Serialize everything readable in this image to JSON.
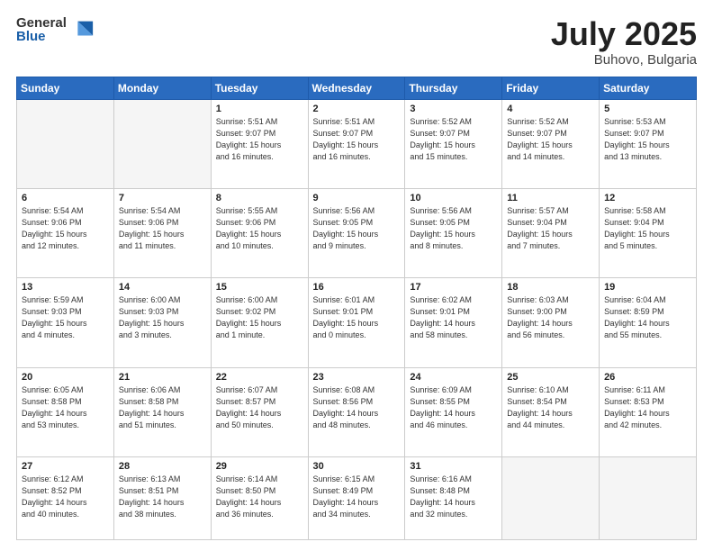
{
  "logo": {
    "general": "General",
    "blue": "Blue"
  },
  "header": {
    "month": "July 2025",
    "location": "Buhovo, Bulgaria"
  },
  "weekdays": [
    "Sunday",
    "Monday",
    "Tuesday",
    "Wednesday",
    "Thursday",
    "Friday",
    "Saturday"
  ],
  "weeks": [
    [
      {
        "day": "",
        "info": ""
      },
      {
        "day": "",
        "info": ""
      },
      {
        "day": "1",
        "info": "Sunrise: 5:51 AM\nSunset: 9:07 PM\nDaylight: 15 hours\nand 16 minutes."
      },
      {
        "day": "2",
        "info": "Sunrise: 5:51 AM\nSunset: 9:07 PM\nDaylight: 15 hours\nand 16 minutes."
      },
      {
        "day": "3",
        "info": "Sunrise: 5:52 AM\nSunset: 9:07 PM\nDaylight: 15 hours\nand 15 minutes."
      },
      {
        "day": "4",
        "info": "Sunrise: 5:52 AM\nSunset: 9:07 PM\nDaylight: 15 hours\nand 14 minutes."
      },
      {
        "day": "5",
        "info": "Sunrise: 5:53 AM\nSunset: 9:07 PM\nDaylight: 15 hours\nand 13 minutes."
      }
    ],
    [
      {
        "day": "6",
        "info": "Sunrise: 5:54 AM\nSunset: 9:06 PM\nDaylight: 15 hours\nand 12 minutes."
      },
      {
        "day": "7",
        "info": "Sunrise: 5:54 AM\nSunset: 9:06 PM\nDaylight: 15 hours\nand 11 minutes."
      },
      {
        "day": "8",
        "info": "Sunrise: 5:55 AM\nSunset: 9:06 PM\nDaylight: 15 hours\nand 10 minutes."
      },
      {
        "day": "9",
        "info": "Sunrise: 5:56 AM\nSunset: 9:05 PM\nDaylight: 15 hours\nand 9 minutes."
      },
      {
        "day": "10",
        "info": "Sunrise: 5:56 AM\nSunset: 9:05 PM\nDaylight: 15 hours\nand 8 minutes."
      },
      {
        "day": "11",
        "info": "Sunrise: 5:57 AM\nSunset: 9:04 PM\nDaylight: 15 hours\nand 7 minutes."
      },
      {
        "day": "12",
        "info": "Sunrise: 5:58 AM\nSunset: 9:04 PM\nDaylight: 15 hours\nand 5 minutes."
      }
    ],
    [
      {
        "day": "13",
        "info": "Sunrise: 5:59 AM\nSunset: 9:03 PM\nDaylight: 15 hours\nand 4 minutes."
      },
      {
        "day": "14",
        "info": "Sunrise: 6:00 AM\nSunset: 9:03 PM\nDaylight: 15 hours\nand 3 minutes."
      },
      {
        "day": "15",
        "info": "Sunrise: 6:00 AM\nSunset: 9:02 PM\nDaylight: 15 hours\nand 1 minute."
      },
      {
        "day": "16",
        "info": "Sunrise: 6:01 AM\nSunset: 9:01 PM\nDaylight: 15 hours\nand 0 minutes."
      },
      {
        "day": "17",
        "info": "Sunrise: 6:02 AM\nSunset: 9:01 PM\nDaylight: 14 hours\nand 58 minutes."
      },
      {
        "day": "18",
        "info": "Sunrise: 6:03 AM\nSunset: 9:00 PM\nDaylight: 14 hours\nand 56 minutes."
      },
      {
        "day": "19",
        "info": "Sunrise: 6:04 AM\nSunset: 8:59 PM\nDaylight: 14 hours\nand 55 minutes."
      }
    ],
    [
      {
        "day": "20",
        "info": "Sunrise: 6:05 AM\nSunset: 8:58 PM\nDaylight: 14 hours\nand 53 minutes."
      },
      {
        "day": "21",
        "info": "Sunrise: 6:06 AM\nSunset: 8:58 PM\nDaylight: 14 hours\nand 51 minutes."
      },
      {
        "day": "22",
        "info": "Sunrise: 6:07 AM\nSunset: 8:57 PM\nDaylight: 14 hours\nand 50 minutes."
      },
      {
        "day": "23",
        "info": "Sunrise: 6:08 AM\nSunset: 8:56 PM\nDaylight: 14 hours\nand 48 minutes."
      },
      {
        "day": "24",
        "info": "Sunrise: 6:09 AM\nSunset: 8:55 PM\nDaylight: 14 hours\nand 46 minutes."
      },
      {
        "day": "25",
        "info": "Sunrise: 6:10 AM\nSunset: 8:54 PM\nDaylight: 14 hours\nand 44 minutes."
      },
      {
        "day": "26",
        "info": "Sunrise: 6:11 AM\nSunset: 8:53 PM\nDaylight: 14 hours\nand 42 minutes."
      }
    ],
    [
      {
        "day": "27",
        "info": "Sunrise: 6:12 AM\nSunset: 8:52 PM\nDaylight: 14 hours\nand 40 minutes."
      },
      {
        "day": "28",
        "info": "Sunrise: 6:13 AM\nSunset: 8:51 PM\nDaylight: 14 hours\nand 38 minutes."
      },
      {
        "day": "29",
        "info": "Sunrise: 6:14 AM\nSunset: 8:50 PM\nDaylight: 14 hours\nand 36 minutes."
      },
      {
        "day": "30",
        "info": "Sunrise: 6:15 AM\nSunset: 8:49 PM\nDaylight: 14 hours\nand 34 minutes."
      },
      {
        "day": "31",
        "info": "Sunrise: 6:16 AM\nSunset: 8:48 PM\nDaylight: 14 hours\nand 32 minutes."
      },
      {
        "day": "",
        "info": ""
      },
      {
        "day": "",
        "info": ""
      }
    ]
  ]
}
